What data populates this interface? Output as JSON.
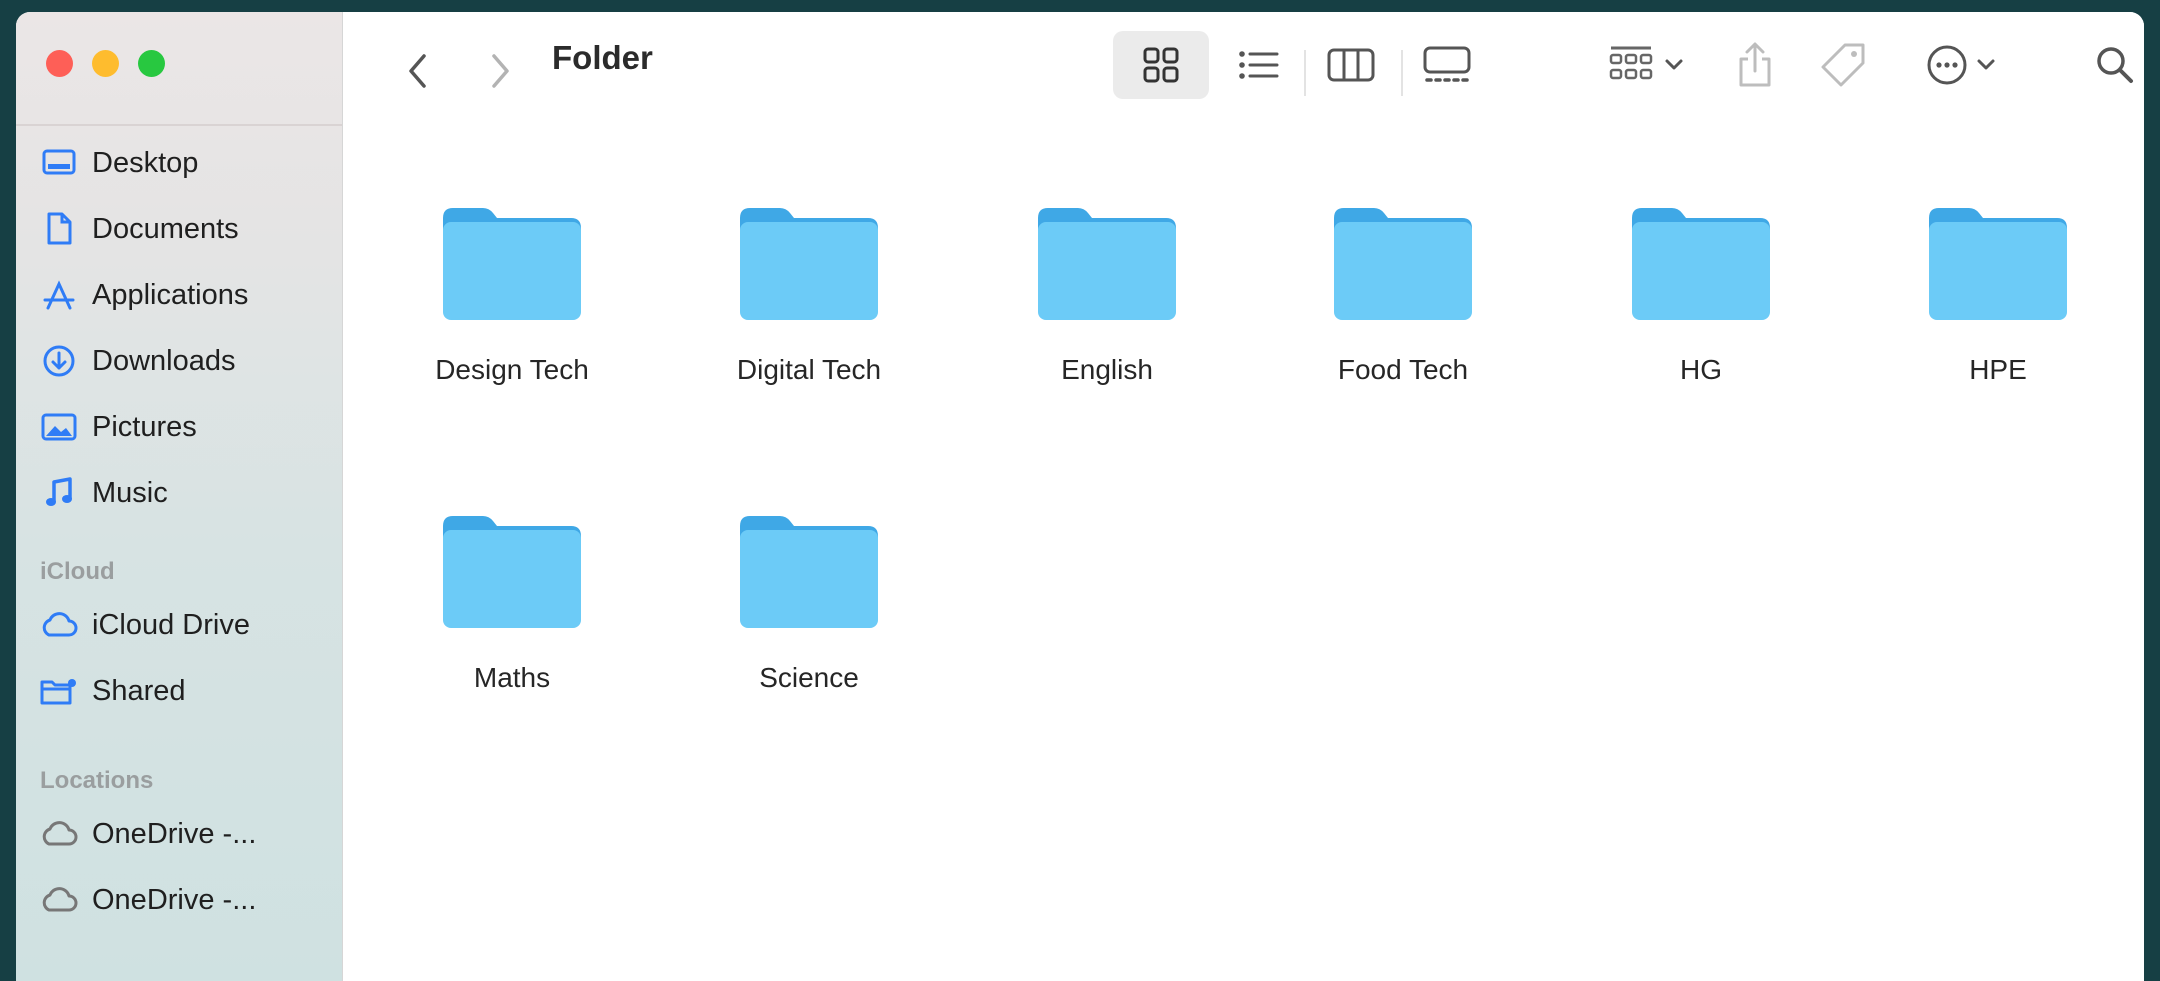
{
  "window": {
    "title": "Folder"
  },
  "sidebar": {
    "favorites": [
      {
        "label": "Desktop",
        "icon": "desktop-icon"
      },
      {
        "label": "Documents",
        "icon": "document-icon"
      },
      {
        "label": "Applications",
        "icon": "applications-icon"
      },
      {
        "label": "Downloads",
        "icon": "download-icon"
      },
      {
        "label": "Pictures",
        "icon": "pictures-icon"
      },
      {
        "label": "Music",
        "icon": "music-note-icon"
      }
    ],
    "icloud_header": "iCloud",
    "icloud": [
      {
        "label": "iCloud Drive",
        "icon": "cloud-icon"
      },
      {
        "label": "Shared",
        "icon": "shared-folder-icon"
      }
    ],
    "locations_header": "Locations",
    "locations": [
      {
        "label": "OneDrive -...",
        "icon": "cloud-icon"
      },
      {
        "label": "OneDrive -...",
        "icon": "cloud-icon"
      }
    ]
  },
  "folders": [
    {
      "name": "Design Tech"
    },
    {
      "name": "Digital Tech"
    },
    {
      "name": "English"
    },
    {
      "name": "Food Tech"
    },
    {
      "name": "HG"
    },
    {
      "name": "HPE"
    },
    {
      "name": "Maths"
    },
    {
      "name": "Science"
    }
  ],
  "colors": {
    "accent": "#2f7cf6",
    "folder_body": "#6ccbf7",
    "folder_tab": "#3fa8e6",
    "background": "#163f44"
  }
}
